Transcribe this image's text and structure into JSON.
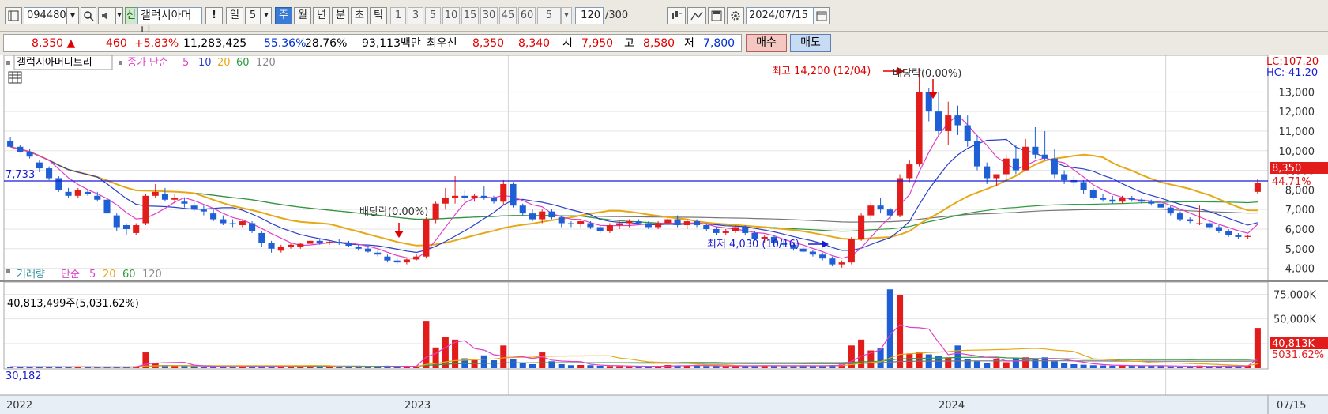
{
  "toolbar": {
    "stock_code": "094480",
    "credit_badge": "신",
    "stock_name": "갤럭시아머니",
    "period_buttons": [
      "일",
      "주",
      "월",
      "년",
      "분",
      "초",
      "틱"
    ],
    "active_period": "주",
    "day_count": "5",
    "number_buttons": [
      "1",
      "3",
      "5",
      "10",
      "15",
      "30",
      "45",
      "60"
    ],
    "interval_value": "5",
    "count_value": "120",
    "count_max": "/300",
    "date_value": "2024/07/15",
    "icons": [
      "search-icon",
      "speaker-icon",
      "compare-icon",
      "drawing-icon",
      "save-icon",
      "gear-icon",
      "calendar-icon"
    ]
  },
  "quote": {
    "price": "8,350",
    "change": "460",
    "change_rate": "+5.83%",
    "volume": "11,283,425",
    "ratio1": "55.36%",
    "ratio2": "28.76%",
    "trade_value": "93,113백만",
    "best_label": "최우선",
    "best_ask": "8,350",
    "best_bid": "8,340",
    "open_label": "시",
    "open": "7,950",
    "high_label": "고",
    "high": "8,580",
    "low_label": "저",
    "low": "7,800",
    "buy_label": "매수",
    "sell_label": "매도"
  },
  "price_panel": {
    "legend_name": "갤럭시아머니트리",
    "legend_ma_label": "종가 단순",
    "legend_ma_periods": [
      "5",
      "10",
      "20",
      "60",
      "120"
    ],
    "lc_label": "LC:107.20",
    "hc_label": "HC:-41.20",
    "hline_label": "7,733",
    "current_price_tag": "8,350",
    "current_pct_tag": "44.71%",
    "annotations": {
      "high": "최고 14,200 (12/04)",
      "low": "최저 4,030 (10/16)",
      "dividend1": "배당락(0.00%)",
      "dividend2": "배당락(0.00%)"
    }
  },
  "volume_panel": {
    "legend_label": "거래량",
    "legend_ma_label": "단순",
    "legend_ma_periods": [
      "5",
      "20",
      "60",
      "120"
    ],
    "last_volume": "40,813,499주(5,031.62%)",
    "left_value": "30,182",
    "current_tag": "40,813K",
    "current_pct_tag": "5031.62%"
  },
  "x_axis": {
    "labels": [
      "2022",
      "2023",
      "2024"
    ],
    "cursor_date": "07/15"
  },
  "colors": {
    "up": "#e21b1b",
    "down": "#1e5fd6",
    "ma5": "#e040c8",
    "ma10": "#2a3fc7",
    "ma20": "#e6a817",
    "ma60": "#2e9a3e",
    "ma120": "#777777"
  },
  "chart_data": {
    "type": "line",
    "price_axis": {
      "ticks": [
        "4,000",
        "5,000",
        "6,000",
        "7,000",
        "8,000",
        "9,000",
        "10,000",
        "11,000",
        "12,000",
        "13,000"
      ],
      "ylim": [
        3500,
        13900
      ]
    },
    "volume_axis": {
      "ticks": [
        "25,000K",
        "50,000K",
        "75,000K"
      ],
      "ylim": [
        0,
        85000
      ]
    },
    "candles": [
      [
        10500,
        10700,
        10200,
        10200
      ],
      [
        10200,
        10300,
        9900,
        9950
      ],
      [
        9950,
        10100,
        9600,
        9700
      ],
      [
        9400,
        9500,
        8900,
        9100
      ],
      [
        9100,
        9200,
        8500,
        8600
      ],
      [
        8600,
        8700,
        7900,
        8000
      ],
      [
        7900,
        8100,
        7600,
        7700
      ],
      [
        7700,
        8100,
        7600,
        8000
      ],
      [
        7900,
        8000,
        7700,
        7800
      ],
      [
        7700,
        7900,
        7400,
        7500
      ],
      [
        7500,
        7700,
        6600,
        6800
      ],
      [
        6700,
        6800,
        5900,
        6100
      ],
      [
        6200,
        6300,
        5700,
        6000
      ],
      [
        5800,
        6300,
        5700,
        6200
      ],
      [
        6300,
        7800,
        6200,
        7700
      ],
      [
        7700,
        8300,
        7600,
        7900
      ],
      [
        7800,
        8100,
        7400,
        7500
      ],
      [
        7500,
        7800,
        7300,
        7600
      ],
      [
        7400,
        7600,
        7100,
        7300
      ],
      [
        7200,
        7400,
        6900,
        7000
      ],
      [
        7000,
        7200,
        6700,
        6900
      ],
      [
        6800,
        7000,
        6400,
        6500
      ],
      [
        6500,
        6700,
        6200,
        6300
      ],
      [
        6300,
        6500,
        6100,
        6250
      ],
      [
        6200,
        6500,
        6100,
        6400
      ],
      [
        6300,
        6400,
        5800,
        5900
      ],
      [
        5800,
        5900,
        5100,
        5300
      ],
      [
        5300,
        5400,
        4800,
        5000
      ],
      [
        4900,
        5200,
        4800,
        5100
      ],
      [
        5100,
        5300,
        5000,
        5200
      ],
      [
        5100,
        5300,
        5000,
        5250
      ],
      [
        5250,
        5500,
        5200,
        5400
      ],
      [
        5400,
        5500,
        5200,
        5300
      ],
      [
        5300,
        5400,
        5200,
        5350
      ],
      [
        5350,
        5500,
        5200,
        5300
      ],
      [
        5300,
        5400,
        5100,
        5150
      ],
      [
        5100,
        5200,
        4900,
        5000
      ],
      [
        5000,
        5100,
        4800,
        4850
      ],
      [
        4800,
        4900,
        4600,
        4700
      ],
      [
        4600,
        4700,
        4300,
        4400
      ],
      [
        4400,
        4500,
        4200,
        4300
      ],
      [
        4300,
        4500,
        4200,
        4450
      ],
      [
        4450,
        4700,
        4400,
        4600
      ],
      [
        4600,
        6600,
        4500,
        6500
      ],
      [
        6500,
        7400,
        6300,
        7300
      ],
      [
        7300,
        8100,
        7000,
        7600
      ],
      [
        7600,
        8700,
        7300,
        7700
      ],
      [
        7700,
        8000,
        7400,
        7600
      ],
      [
        7600,
        7800,
        7400,
        7700
      ],
      [
        7700,
        8200,
        7500,
        7600
      ],
      [
        7600,
        7700,
        7300,
        7400
      ],
      [
        7400,
        8500,
        7200,
        8300
      ],
      [
        8300,
        8400,
        7100,
        7200
      ],
      [
        7200,
        7300,
        6700,
        6800
      ],
      [
        6800,
        7000,
        6400,
        6500
      ],
      [
        6500,
        7000,
        6300,
        6900
      ],
      [
        6900,
        7000,
        6500,
        6600
      ],
      [
        6600,
        6700,
        6100,
        6300
      ],
      [
        6300,
        6400,
        6100,
        6250
      ],
      [
        6250,
        6500,
        6100,
        6400
      ],
      [
        6300,
        6400,
        6000,
        6100
      ],
      [
        6100,
        6200,
        5800,
        5900
      ],
      [
        5900,
        6300,
        5800,
        6200
      ],
      [
        6200,
        6400,
        6000,
        6300
      ],
      [
        6300,
        6500,
        6100,
        6400
      ],
      [
        6400,
        6500,
        6200,
        6300
      ],
      [
        6300,
        6400,
        6000,
        6100
      ],
      [
        6100,
        6400,
        6000,
        6300
      ],
      [
        6300,
        6600,
        6200,
        6500
      ],
      [
        6500,
        6700,
        6100,
        6200
      ],
      [
        6200,
        6500,
        6000,
        6400
      ],
      [
        6400,
        6500,
        6100,
        6200
      ],
      [
        6200,
        6300,
        5900,
        6000
      ],
      [
        6000,
        6100,
        5700,
        5800
      ],
      [
        5800,
        6000,
        5700,
        5900
      ],
      [
        5900,
        6200,
        5800,
        6100
      ],
      [
        6100,
        6200,
        5700,
        5800
      ],
      [
        5800,
        5900,
        5400,
        5500
      ],
      [
        5500,
        5700,
        5300,
        5600
      ],
      [
        5600,
        5700,
        5200,
        5300
      ],
      [
        5300,
        5400,
        5100,
        5200
      ],
      [
        5200,
        5300,
        4900,
        5000
      ],
      [
        5000,
        5100,
        4800,
        4850
      ],
      [
        4850,
        4950,
        4600,
        4700
      ],
      [
        4700,
        4800,
        4400,
        4500
      ],
      [
        4500,
        4600,
        4100,
        4200
      ],
      [
        4200,
        4400,
        4030,
        4300
      ],
      [
        4300,
        5600,
        4200,
        5500
      ],
      [
        5500,
        6800,
        5400,
        6700
      ],
      [
        6700,
        7400,
        6500,
        7200
      ],
      [
        7200,
        7600,
        6800,
        7000
      ],
      [
        7000,
        7100,
        6500,
        6700
      ],
      [
        6700,
        8800,
        6600,
        8600
      ],
      [
        8600,
        9500,
        8400,
        9300
      ],
      [
        9300,
        14200,
        9200,
        13000
      ],
      [
        13000,
        13200,
        11500,
        12000
      ],
      [
        12000,
        13000,
        10800,
        11000
      ],
      [
        11000,
        12500,
        10300,
        11800
      ],
      [
        11800,
        12300,
        10800,
        11300
      ],
      [
        11300,
        11800,
        10200,
        10500
      ],
      [
        10500,
        10800,
        9000,
        9200
      ],
      [
        9200,
        9400,
        8300,
        8600
      ],
      [
        8600,
        8800,
        8200,
        8800
      ],
      [
        8800,
        9800,
        8500,
        9600
      ],
      [
        9600,
        10300,
        8800,
        9000
      ],
      [
        9000,
        10600,
        9000,
        10200
      ],
      [
        10200,
        11200,
        9600,
        9800
      ],
      [
        9800,
        11000,
        9500,
        9600
      ],
      [
        9600,
        10100,
        8600,
        8800
      ],
      [
        8800,
        9000,
        8300,
        8500
      ],
      [
        8500,
        8700,
        8200,
        8400
      ],
      [
        8400,
        8500,
        7800,
        8000
      ],
      [
        8000,
        8100,
        7500,
        7600
      ],
      [
        7600,
        7800,
        7400,
        7500
      ],
      [
        7500,
        7700,
        7300,
        7400
      ],
      [
        7400,
        7700,
        7300,
        7600
      ],
      [
        7600,
        7700,
        7400,
        7500
      ],
      [
        7500,
        7600,
        7300,
        7400
      ],
      [
        7400,
        7500,
        7200,
        7300
      ],
      [
        7300,
        7400,
        7000,
        7100
      ],
      [
        7100,
        7200,
        6700,
        6800
      ],
      [
        6800,
        6900,
        6400,
        6500
      ],
      [
        6500,
        6600,
        6300,
        6400
      ],
      [
        6300,
        7200,
        6200,
        6300
      ],
      [
        6300,
        6400,
        6000,
        6100
      ],
      [
        6100,
        6200,
        5800,
        5900
      ],
      [
        5900,
        6000,
        5600,
        5700
      ],
      [
        5700,
        5800,
        5500,
        5600
      ],
      [
        5600,
        5700,
        5500,
        5650
      ],
      [
        7900,
        8580,
        7800,
        8350
      ]
    ],
    "volumes": [
      1500,
      1300,
      1200,
      1100,
      1500,
      1200,
      1000,
      1400,
      1100,
      900,
      900,
      1100,
      1200,
      1800,
      16000,
      5600,
      3200,
      2400,
      2300,
      2200,
      1500,
      1400,
      1200,
      1300,
      2700,
      1700,
      1400,
      1300,
      1300,
      1300,
      1200,
      1400,
      1200,
      1300,
      1200,
      1200,
      1200,
      1300,
      1700,
      2500,
      2200,
      1900,
      1700,
      48000,
      21000,
      32000,
      29000,
      10000,
      8000,
      13000,
      8000,
      23000,
      9000,
      5000,
      4000,
      16000,
      7000,
      4000,
      3000,
      3200,
      3000,
      2400,
      2100,
      2000,
      1900,
      1800,
      1700,
      2400,
      3200,
      2800,
      2700,
      2400,
      2200,
      2200,
      2300,
      2400,
      2500,
      2700,
      2500,
      2300,
      2500,
      2600,
      2400,
      2300,
      2300,
      3100,
      3700,
      23000,
      29000,
      18000,
      20000,
      80000,
      74000,
      15000,
      16000,
      14000,
      12000,
      11000,
      23000,
      9000,
      7000,
      5000,
      9000,
      6000,
      10000,
      11000,
      10000,
      11000,
      7000,
      5000,
      4000,
      3500,
      3000,
      2800,
      2500,
      2600,
      2400,
      2600,
      2800,
      2200,
      1800,
      1600,
      1500,
      2600,
      2300,
      2000,
      1900,
      2100,
      2600,
      40813
    ]
  }
}
